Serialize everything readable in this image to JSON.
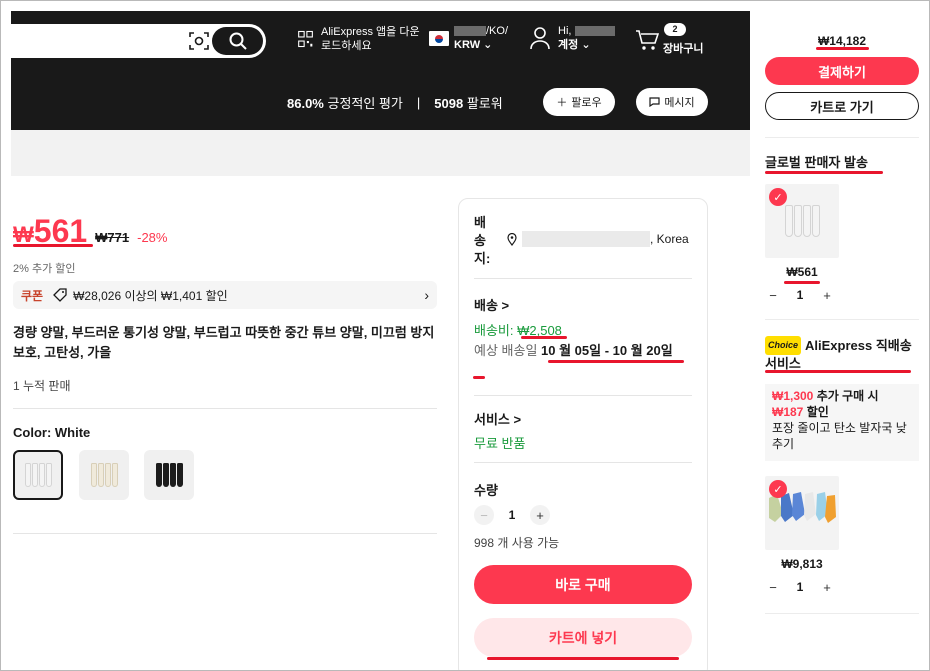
{
  "header": {
    "app_download": "AliExpress 앱을 다운로드하세요",
    "region_suffix": "/KO/",
    "currency": "KRW",
    "greeting": "Hi,",
    "account_label": "계정",
    "cart_count": "2",
    "cart_label": "장바구니"
  },
  "store": {
    "positive_pct": "86.0%",
    "positive_label": "긍정적인 평가",
    "followers": "5098",
    "followers_label": "팔로워",
    "follow_btn": "팔로우",
    "message_btn": "메시지"
  },
  "product": {
    "currency_symbol": "₩",
    "price": "561",
    "old_price": "₩771",
    "discount": "-28%",
    "extra_discount": "2% 추가 할인",
    "coupon_tag": "쿠폰",
    "coupon_text": "₩28,026 이상의 ₩1,401 할인",
    "title": "경량 양말, 부드러운 통기성 양말, 부드럽고 따뜻한 중간 튜브 양말, 미끄럼 방지 보호, 고탄성, 가을",
    "sold": "1 누적 판매",
    "color_label": "Color: White",
    "swatches": [
      {
        "name": "White",
        "color": "#f4f4f4"
      },
      {
        "name": "Beige",
        "color": "#f0eadb"
      },
      {
        "name": "Black",
        "color": "#1c1c1c"
      }
    ]
  },
  "shipping": {
    "ship_to_label": "배송지:",
    "ship_to_country": ", Korea",
    "delivery_header": "배송 >",
    "fee_label": "배송비: ",
    "fee_value": "₩2,508",
    "eta_label": "예상 배송일 ",
    "eta_value": "10 월 05일 - 10 월 20일",
    "service_header": "서비스 >",
    "free_return": "무료 반품",
    "qty_label": "수량",
    "qty_value": "1",
    "available": "998 개 사용 가능",
    "buy_now": "바로 구매",
    "add_cart": "카트에 넣기"
  },
  "sidebar": {
    "total": "₩14,182",
    "checkout": "결제하기",
    "go_cart": "카트로 가기",
    "section1": "글로벌 판매자 발송",
    "item1_price": "₩561",
    "item1_qty": "1",
    "choice_badge": "Choice",
    "section2": "AliExpress 직배송 서비스",
    "promo_amount1": "₩1,300",
    "promo_text1": " 추가 구매 시",
    "promo_amount2": "₩187",
    "promo_text2": " 할인",
    "promo_text3": "포장 줄이고 탄소 발자국 낮추기",
    "item2_price": "₩9,813",
    "item2_qty": "1"
  },
  "colors": {
    "accent": "#fd384f",
    "header_bg": "#191919",
    "ship_fee": "#1a9b3c"
  }
}
